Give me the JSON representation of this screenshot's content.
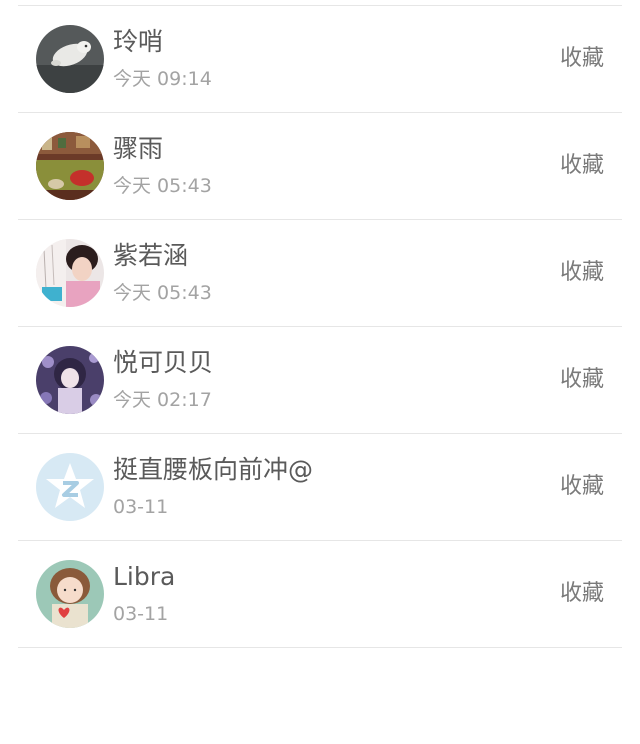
{
  "contacts": [
    {
      "name": "玲哨",
      "time": "今天 09:14",
      "action": "收藏",
      "avatar_icon": "dog-photo-avatar"
    },
    {
      "name": "骤雨",
      "time": "今天 05:43",
      "action": "收藏",
      "avatar_icon": "room-photo-avatar"
    },
    {
      "name": "紫若涵",
      "time": "今天 05:43",
      "action": "收藏",
      "avatar_icon": "girl-photo-avatar"
    },
    {
      "name": "悦可贝贝",
      "time": "今天 02:17",
      "action": "收藏",
      "avatar_icon": "anime-girl-avatar"
    },
    {
      "name": "挺直腰板向前冲@",
      "time": "03-11",
      "action": "收藏",
      "avatar_icon": "qzone-star-avatar"
    },
    {
      "name": "Libra",
      "time": "03-11",
      "action": "收藏",
      "avatar_icon": "cartoon-girl-heart-avatar"
    }
  ],
  "colors": {
    "divider": "#e6e6e6",
    "name_text": "#5a5a5a",
    "time_text": "#a3a3a3",
    "action_text": "#7a7a7a"
  }
}
